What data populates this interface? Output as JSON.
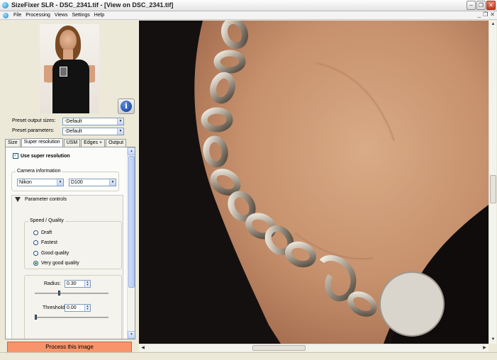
{
  "window": {
    "title": "SizeFixer SLR - DSC_2341.tif - [View on DSC_2341.tif]"
  },
  "menu": {
    "items": [
      "File",
      "Processing",
      "Views",
      "Settings",
      "Help"
    ]
  },
  "left_panel": {
    "preset_output_label": "Preset output sizes:",
    "preset_output_value": "-Default",
    "preset_params_label": "Preset parameters:",
    "preset_params_value": "-Default",
    "tabs": [
      "Size",
      "Super resolution",
      "USM",
      "Edges +",
      "Output"
    ],
    "active_tab": "Super resolution",
    "use_super_resolution_label": "Use super resolution",
    "use_super_resolution_checked": true,
    "camera_info": {
      "title": "Camera information",
      "maker": "Nikon",
      "model": "D100"
    },
    "parameter_controls_label": "Parameter controls",
    "speed_quality": {
      "title": "Speed / Quality",
      "options": [
        "Draft",
        "Fastest",
        "Good quality",
        "Very good quality"
      ],
      "selected": "Very good quality"
    },
    "radius_label": "Radius:",
    "radius_value": "0.30",
    "threshold_label": "Threshold:",
    "threshold_value": "0.00",
    "process_button": "Process this image"
  },
  "icons": {
    "info": "info-icon",
    "app": "sizefixer-app-icon"
  },
  "colors": {
    "process_button": "#f7946b",
    "window_bg": "#ece9d8"
  }
}
